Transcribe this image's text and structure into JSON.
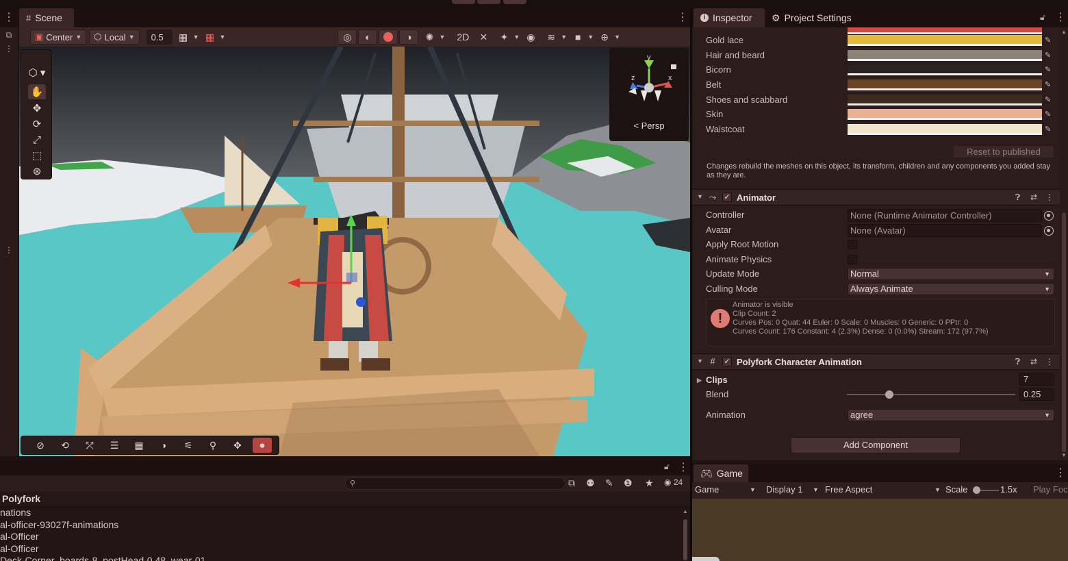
{
  "scene": {
    "tab_label": "Scene",
    "toolbar": {
      "pivot_label": "Center",
      "space_label": "Local",
      "snap_value": "0.5"
    },
    "camera_label": "Persp",
    "axis_labels": {
      "x": "x",
      "y": "y",
      "z": "z"
    }
  },
  "inspector": {
    "tab_label": "Inspector",
    "project_settings_label": "Project Settings",
    "colors": [
      {
        "label": "Gold lace",
        "value": "#e4b83a"
      },
      {
        "label": "Hair and beard",
        "value": "#8f8276"
      },
      {
        "label": "Bicorn",
        "value": "#2a2220"
      },
      {
        "label": "Belt",
        "value": "#6a4324"
      },
      {
        "label": "Shoes and scabbard",
        "value": "#3d2a1e"
      },
      {
        "label": "Skin",
        "value": "#eab08d"
      },
      {
        "label": "Waistcoat",
        "value": "#f1e4c9"
      }
    ],
    "reset_button": "Reset to published",
    "note": "Changes rebuild the meshes on this object, its transform, children and any components you added stay as they are.",
    "animator": {
      "title": "Animator",
      "controller_label": "Controller",
      "controller_value": "None (Runtime Animator Controller)",
      "avatar_label": "Avatar",
      "avatar_value": "None (Avatar)",
      "apply_root_motion_label": "Apply Root Motion",
      "animate_physics_label": "Animate Physics",
      "update_mode_label": "Update Mode",
      "update_mode_value": "Normal",
      "culling_mode_label": "Culling Mode",
      "culling_mode_value": "Always Animate",
      "info": [
        "Animator is visible",
        "Clip Count: 2",
        "Curves Pos: 0 Quat: 44 Euler: 0 Scale: 0 Muscles: 0 Generic: 0 PPtr: 0",
        "Curves Count: 176 Constant: 4 (2.3%) Dense: 0 (0.0%) Stream: 172 (97.7%)"
      ]
    },
    "polyfork": {
      "title": "Polyfork Character Animation",
      "clips_label": "Clips",
      "clips_value": "7",
      "blend_label": "Blend",
      "blend_value": "0.25",
      "blend_fraction": 0.25,
      "animation_label": "Animation",
      "animation_value": "agree"
    },
    "add_component": "Add Component"
  },
  "project": {
    "breadcrumb": "Polyfork",
    "hidden_count": "24",
    "items": [
      "nations",
      "al-officer-93027f-animations",
      "al-Officer",
      "al-Officer",
      "Deck-Corner_boards-8_postHead-0.48_wear-01"
    ]
  },
  "game": {
    "tab_label": "Game",
    "mode_label": "Game",
    "display_label": "Display 1",
    "aspect_label": "Free Aspect",
    "scale_label": "Scale",
    "scale_value": "1.5x",
    "play_focused_label": "Play Foc"
  }
}
